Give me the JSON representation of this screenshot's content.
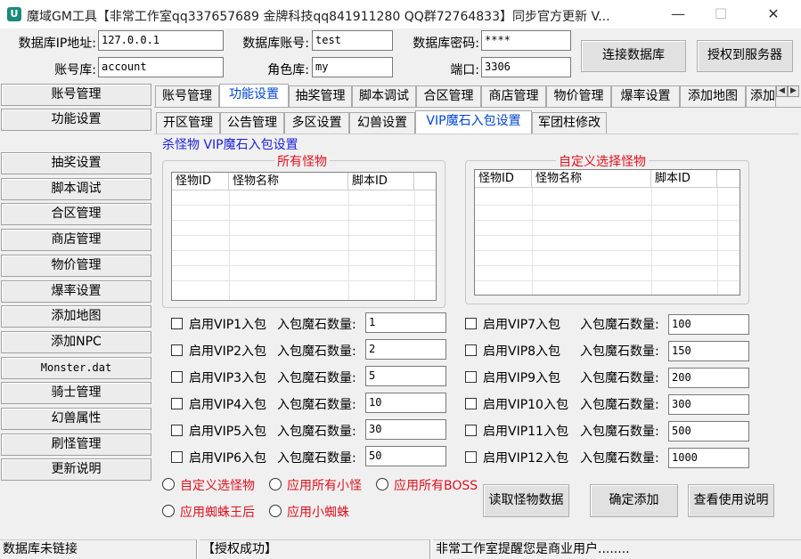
{
  "window": {
    "title": "魔域GM工具【非常工作室qq337657689 金牌科技qq841911280 QQ群72764833】同步官方更新 V...",
    "icon_name": "app-logo-icon",
    "minimize": "—",
    "maximize": "☐",
    "close": "✕"
  },
  "connection": {
    "ip_label": "数据库IP地址:",
    "ip_value": "127.0.0.1",
    "db_user_label": "数据库账号:",
    "db_user_value": "test",
    "db_pass_label": "数据库密码:",
    "db_pass_value": "****",
    "account_db_label": "账号库:",
    "account_db_value": "account",
    "role_db_label": "角色库:",
    "role_db_value": "my",
    "port_label": "端口:",
    "port_value": "3306",
    "connect_button": "连接数据库",
    "authorize_button": "授权到服务器"
  },
  "sidebar": {
    "items": [
      {
        "label": "账号管理"
      },
      {
        "label": "功能设置"
      },
      {
        "label": "抽奖设置"
      },
      {
        "label": "脚本调试"
      },
      {
        "label": "合区管理"
      },
      {
        "label": "商店管理"
      },
      {
        "label": "物价管理"
      },
      {
        "label": "爆率设置"
      },
      {
        "label": "添加地图"
      },
      {
        "label": "添加NPC"
      },
      {
        "label": "Monster.dat"
      },
      {
        "label": "骑士管理"
      },
      {
        "label": "幻兽属性"
      },
      {
        "label": "刷怪管理"
      },
      {
        "label": "更新说明"
      }
    ]
  },
  "main_tabs": [
    {
      "label": "账号管理"
    },
    {
      "label": "功能设置"
    },
    {
      "label": "抽奖管理"
    },
    {
      "label": "脚本调试"
    },
    {
      "label": "合区管理"
    },
    {
      "label": "商店管理"
    },
    {
      "label": "物价管理"
    },
    {
      "label": "爆率设置"
    },
    {
      "label": "添加地图"
    },
    {
      "label": "添加NPC"
    }
  ],
  "sub_tabs": [
    {
      "label": "开区管理"
    },
    {
      "label": "公告管理"
    },
    {
      "label": "多区设置"
    },
    {
      "label": "幻兽设置"
    },
    {
      "label": "VIP魔石入包设置"
    },
    {
      "label": "军团柱修改"
    }
  ],
  "vip_panel": {
    "group_title": "杀怪物 VIP魔石入包设置",
    "all_monsters": {
      "title": "所有怪物",
      "columns": [
        "怪物ID",
        "怪物名称",
        "脚本ID"
      ]
    },
    "custom_monsters": {
      "title": "自定义选择怪物",
      "columns": [
        "怪物ID",
        "怪物名称",
        "脚本ID"
      ]
    },
    "amount_label": "入包魔石数量:",
    "vips": [
      {
        "label": "启用VIP1入包",
        "amount": "1",
        "checked": false
      },
      {
        "label": "启用VIP2入包",
        "amount": "2",
        "checked": false
      },
      {
        "label": "启用VIP3入包",
        "amount": "5",
        "checked": false
      },
      {
        "label": "启用VIP4入包",
        "amount": "10",
        "checked": false
      },
      {
        "label": "启用VIP5入包",
        "amount": "30",
        "checked": false
      },
      {
        "label": "启用VIP6入包",
        "amount": "50",
        "checked": false
      },
      {
        "label": "启用VIP7入包",
        "amount": "100",
        "checked": false
      },
      {
        "label": "启用VIP8入包",
        "amount": "150",
        "checked": false
      },
      {
        "label": "启用VIP9入包",
        "amount": "200",
        "checked": false
      },
      {
        "label": "启用VIP10入包",
        "amount": "300",
        "checked": false
      },
      {
        "label": "启用VIP11入包",
        "amount": "500",
        "checked": false
      },
      {
        "label": "启用VIP12入包",
        "amount": "1000",
        "checked": false
      }
    ],
    "radios": [
      {
        "label": "自定义选怪物"
      },
      {
        "label": "应用所有小怪"
      },
      {
        "label": "应用所有BOSS"
      },
      {
        "label": "应用蜘蛛王后"
      },
      {
        "label": "应用小蜘蛛"
      }
    ],
    "buttons": {
      "read": "读取怪物数据",
      "confirm": "确定添加",
      "help": "查看使用说明"
    }
  },
  "status_bar": {
    "db_status": "数据库未链接",
    "auth_status": "【授权成功】",
    "notice": "非常工作室提醒您是商业用户........"
  },
  "colors": {
    "group_title": "#1c22d9",
    "legend_red": "#e0111c",
    "active_tab": "#0046d5"
  }
}
